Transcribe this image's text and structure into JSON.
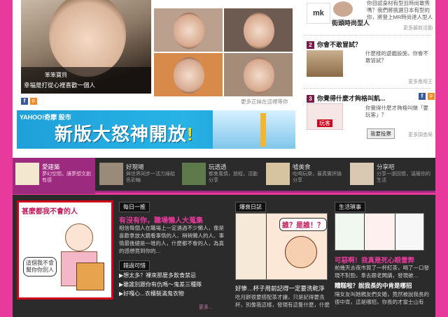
{
  "featured": {
    "name": "笨笨寶貝",
    "caption": "幸福是打從心裡喜歡一個人",
    "more": "更多正妹在這裡等你"
  },
  "yahoo_banner": {
    "brand": "YAHOO!奇摩",
    "brand_sub": "股市",
    "slogan": "新版大怒神開放",
    "bang": "!"
  },
  "right": {
    "item1": {
      "logo": "mk",
      "title": "街頭時尚型人",
      "desc": "你目認身材有型且時尚敢秀嗎？我們將挑選日本有型的你，將登上MR時尚達人型人達人！",
      "more": "更多最新活動"
    },
    "item2": {
      "num": "2",
      "title": "你會不敢冒試？",
      "desc": "什麼樣的遊戲設施，你會不敢冒試？",
      "more": "更多應用王"
    },
    "item3": {
      "num": "3",
      "title": "你覺得什麼才夠格叫飢...",
      "desc": "你覺得什麼才夠格叫做「要玩客」？",
      "badge": "玩客",
      "vote": "我要投票",
      "more": "更多調查局"
    }
  },
  "nav": [
    {
      "label": "愛建築",
      "desc": "夢幻空間，讓夢想文創有感"
    },
    {
      "label": "好現場",
      "desc": "與世界同步一活力綠給色彩輪"
    },
    {
      "label": "玩透透",
      "desc": "都會風情，旅程，活動分享"
    },
    {
      "label": "噓美食",
      "desc": "吃喝玩樂，最真實評論分享"
    },
    {
      "label": "分享吧",
      "desc": "分享一張回憶，溫暖你的生活"
    }
  ],
  "bottom": {
    "main_comic_title": "甚麼都我不會的人",
    "main_comic_note": "這個我不會幫你你別人",
    "daily": {
      "section": "每日一推",
      "headline": "有沒有你，職場懶人大蒐集",
      "body": "相信每個人在職場上一定遇過不少懶人，像是喜歡拿放大鏡看事情的人、稍稍懶人的人、事情最後總是一堆的人，什麼都不會的人，為真的感想竟到你的…",
      "section2": "錯過可惜",
      "links": [
        "▶想太多？裸來那麼多飲食禁忌",
        "▶雖誰別跟你有仇嗎～鬼差三種隊",
        "▶好嘎心...衣櫃裝滿鬼衣物"
      ],
      "more": "更多..."
    },
    "explode": {
      "section": "爆衰日誌",
      "strip_text": "誰？是誰！？",
      "headline": "好慘…杯子用前記得一定要洗乾淨",
      "body": "吃月餅很要搭配茶才讓，只是記得要洗杯，別像我這樣，發現有這隻什麼，什麼都…"
    },
    "life": {
      "section": "生活瑣事",
      "headline": "可惡啊！我真是死心眼雷弊",
      "body": "前幾天去夜市買了一杯紅茶，喝了一口發現不對勁，拿去跟老闆講，發現被…",
      "headline2": "糟糕啦？說我長的中肯是哪招",
      "body2": "隔女友叫她親友們女婚，竟然被說我長的很中肯，這是哪招，你長的才當士山有好…"
    }
  }
}
